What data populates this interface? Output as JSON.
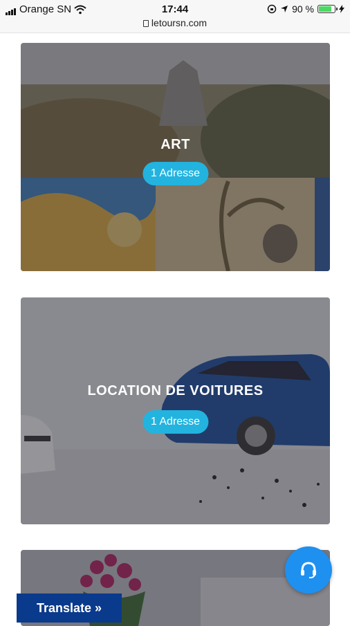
{
  "status": {
    "carrier": "Orange SN",
    "time": "17:44",
    "battery": "90 %",
    "battery_level": 0.9,
    "url": "letoursn.com"
  },
  "cards": [
    {
      "title": "ART",
      "badge": "1 Adresse"
    },
    {
      "title": "LOCATION DE VOITURES",
      "badge": "1 Adresse"
    },
    {
      "title": "",
      "badge": ""
    }
  ],
  "translate": {
    "label": "Translate »"
  },
  "colors": {
    "accent": "#23b3df",
    "fab": "#1e90f0",
    "translate_bg": "#0a3a8c"
  },
  "icons": {
    "fab": "headset-icon"
  }
}
